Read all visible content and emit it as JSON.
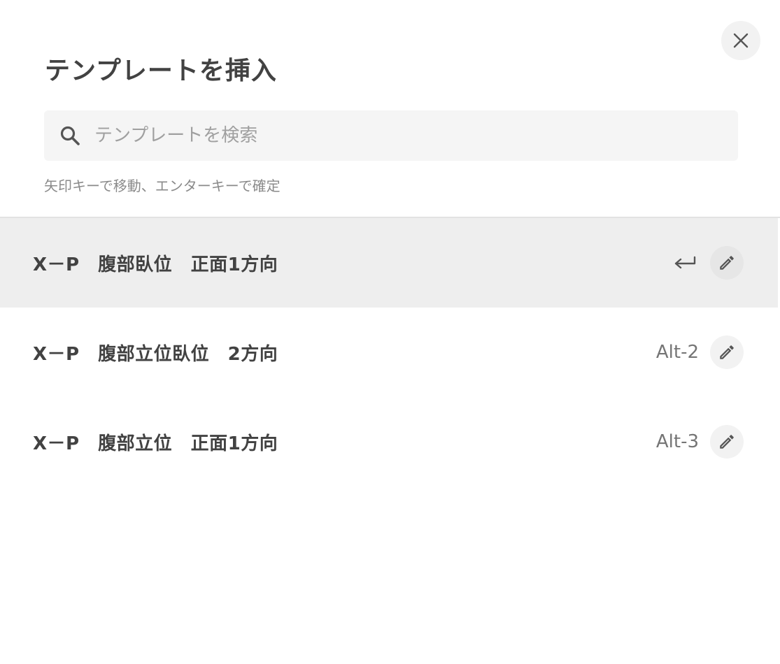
{
  "dialog": {
    "title": "テンプレートを挿入",
    "close_icon": "close-icon"
  },
  "search": {
    "placeholder": "テンプレートを検索",
    "value": "",
    "icon": "search-icon"
  },
  "hint": "矢印キーで移動、エンターキーで確定",
  "templates": [
    {
      "label": "X－P　腹部臥位　正面1方向",
      "shortcut": "",
      "selected": true,
      "trailing_icon": "enter-icon",
      "edit_icon": "pencil-icon"
    },
    {
      "label": "X－P　腹部立位臥位　2方向",
      "shortcut": "Alt-2",
      "selected": false,
      "edit_icon": "pencil-icon"
    },
    {
      "label": "X－P　腹部立位　正面1方向",
      "shortcut": "Alt-3",
      "selected": false,
      "edit_icon": "pencil-icon"
    }
  ],
  "colors": {
    "background": "#ffffff",
    "selected_row": "#eeeeee",
    "text": "#424242",
    "muted_text": "#757575",
    "search_bg": "#f5f5f5"
  }
}
